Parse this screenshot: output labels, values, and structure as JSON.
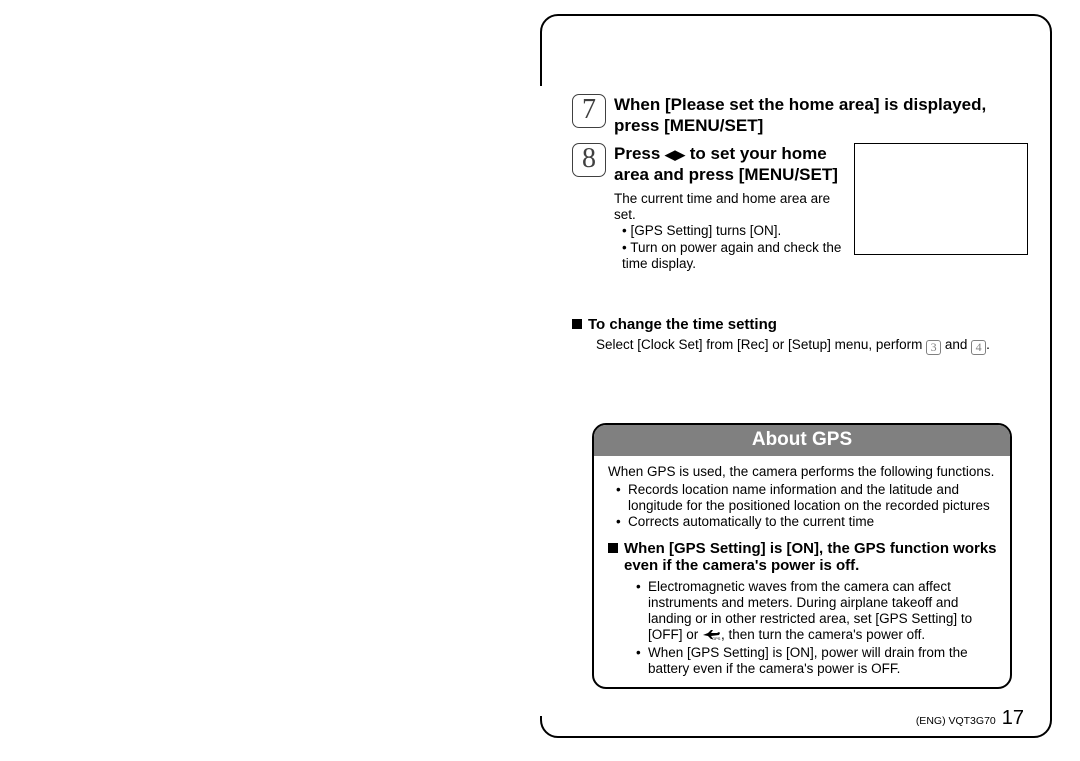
{
  "step7": {
    "number": "7",
    "title": "When [Please set the home area] is displayed, press [MENU/SET]"
  },
  "step8": {
    "number": "8",
    "title_prefix": "Press ",
    "title_suffix": " to set your home area and press [MENU/SET]",
    "body_line1": "The current time and home area are set.",
    "bullets": [
      "[GPS Setting] turns [ON].",
      "Turn on power again and check the time display."
    ]
  },
  "change_time": {
    "heading": "To change the time setting",
    "body_prefix": "Select [Clock Set] from [Rec] or [Setup] menu, perform ",
    "icon_a": "3",
    "mid": " and ",
    "icon_b": "4",
    "suffix": "."
  },
  "gps": {
    "title": "About GPS",
    "intro": "When GPS is used, the camera performs the following functions.",
    "intro_bullets": [
      "Records location name information and the latitude and longitude for the positioned location on the recorded pictures",
      "Corrects automatically to the current time"
    ],
    "sub_heading": "When [GPS Setting] is [ON], the GPS function works even if the camera's power is off.",
    "sub_b1_a": "Electromagnetic waves from the camera can affect instruments and meters. During airplane takeoff and landing or in other restricted area, set [GPS Setting] to [OFF] or ",
    "sub_b1_b": ", then turn the camera's power off.",
    "sub_b2": "When [GPS Setting] is [ON], power will drain from the battery even if the camera's power is OFF."
  },
  "footer": {
    "doc": "(ENG) VQT3G70",
    "page": "17"
  }
}
